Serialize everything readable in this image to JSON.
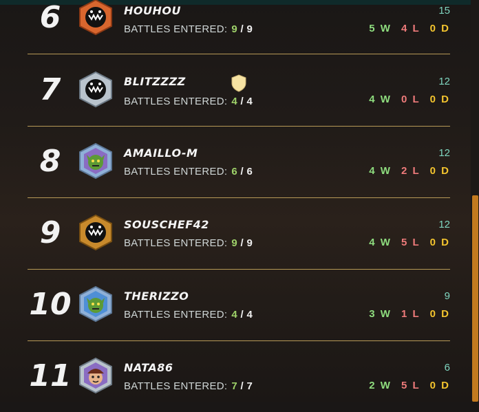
{
  "leaderboard": {
    "rows": [
      {
        "rank": "6",
        "name": "HOUHOU",
        "battles_label": "BATTLES ENTERED:",
        "battles_entered": "9",
        "battles_total": "9",
        "score": "15",
        "wins": "5 W",
        "losses": "4 L",
        "draws": "0 D",
        "avatar_icon": "orange-monster-avatar-icon",
        "has_shield": false
      },
      {
        "rank": "7",
        "name": "BLITZZZZ",
        "battles_label": "BATTLES ENTERED:",
        "battles_entered": "4",
        "battles_total": "4",
        "score": "12",
        "wins": "4 W",
        "losses": "0 L",
        "draws": "0 D",
        "avatar_icon": "silver-monster-avatar-icon",
        "has_shield": true
      },
      {
        "rank": "8",
        "name": "AMAILLO-M",
        "battles_label": "BATTLES ENTERED:",
        "battles_entered": "6",
        "battles_total": "6",
        "score": "12",
        "wins": "4 W",
        "losses": "2 L",
        "draws": "0 D",
        "avatar_icon": "green-goblin-avatar-icon",
        "has_shield": false
      },
      {
        "rank": "9",
        "name": "SOUSCHEF42",
        "battles_label": "BATTLES ENTERED:",
        "battles_entered": "9",
        "battles_total": "9",
        "score": "12",
        "wins": "4 W",
        "losses": "5 L",
        "draws": "0 D",
        "avatar_icon": "gold-monster-avatar-icon",
        "has_shield": false
      },
      {
        "rank": "10",
        "name": "THERIZZO",
        "battles_label": "BATTLES ENTERED:",
        "battles_entered": "4",
        "battles_total": "4",
        "score": "9",
        "wins": "3 W",
        "losses": "1 L",
        "draws": "0 D",
        "avatar_icon": "green-goblin-avatar-icon",
        "has_shield": false
      },
      {
        "rank": "11",
        "name": "NATA86",
        "battles_label": "BATTLES ENTERED:",
        "battles_entered": "7",
        "battles_total": "7",
        "score": "6",
        "wins": "2 W",
        "losses": "5 L",
        "draws": "0 D",
        "avatar_icon": "pirate-avatar-icon",
        "has_shield": false
      }
    ]
  },
  "colors": {
    "win": "#8edc7e",
    "loss": "#ef7b7b",
    "draw": "#f3c42e",
    "score": "#7fd6c0",
    "divider": "#b89a57",
    "scroll_thumb": "#c27a1f"
  }
}
